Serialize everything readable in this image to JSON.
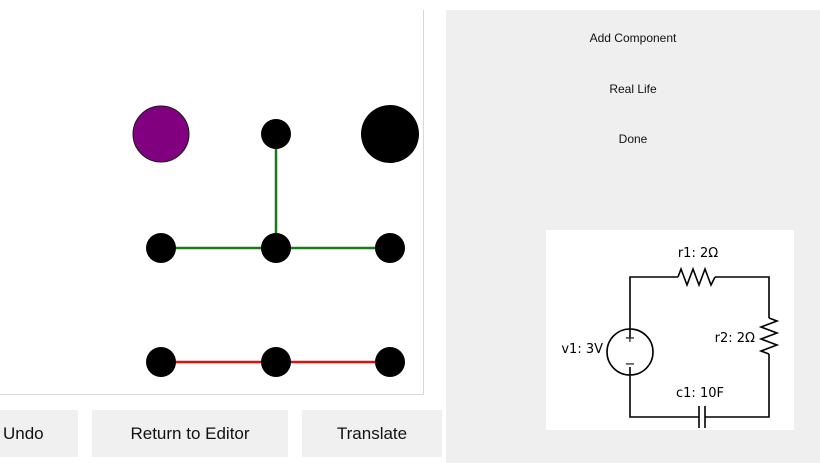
{
  "buttons": {
    "undo": "Undo",
    "return_to_editor": "Return to Editor",
    "translate": "Translate"
  },
  "menu": {
    "add_component": "Add Component",
    "real_life": "Real Life",
    "done": "Done"
  },
  "board": {
    "colors": {
      "node": "#000000",
      "selected_node": "#800080",
      "wire_green": "#1a7a1a",
      "wire_red": "#e01010"
    }
  },
  "schematic": {
    "v1_label": "v1: 3V",
    "r1_label": "r1: 2Ω",
    "r2_label": "r2: 2Ω",
    "c1_label": "c1: 10F",
    "plus_sign": "+",
    "minus_sign": "−"
  }
}
